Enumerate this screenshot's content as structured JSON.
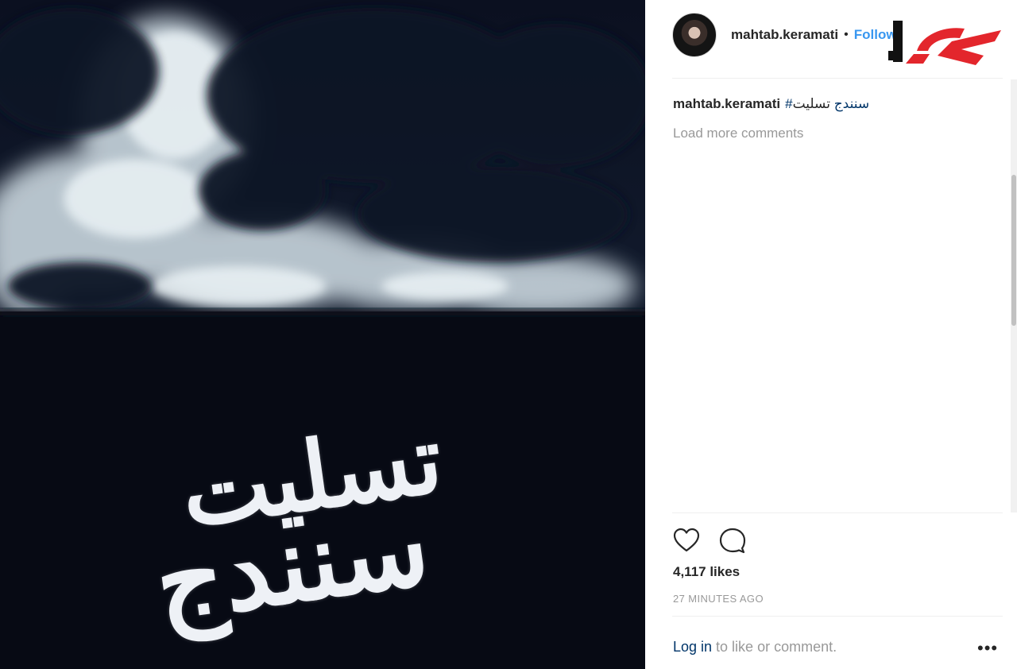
{
  "post": {
    "image_text_line1": "تسلیت",
    "image_text_line2": "سنندج"
  },
  "header": {
    "username": "mahtab.keramati",
    "separator": "•",
    "follow_label": "Follow"
  },
  "caption": {
    "username": "mahtab.keramati",
    "hashtag": "#سنندج",
    "word": "تسلیت"
  },
  "comments": {
    "load_more": "Load more comments"
  },
  "stats": {
    "likes": "4,117 likes",
    "timestamp": "27 MINUTES AGO"
  },
  "footer": {
    "login_label": "Log in",
    "login_suffix": " to like or comment.",
    "more_label": "•••"
  },
  "icons": {
    "like": "heart-icon",
    "comment": "comment-icon",
    "more": "more-options-icon"
  },
  "colors": {
    "link": "#003569",
    "follow": "#3897f0",
    "muted": "#999999",
    "logo_red": "#e3262c"
  }
}
